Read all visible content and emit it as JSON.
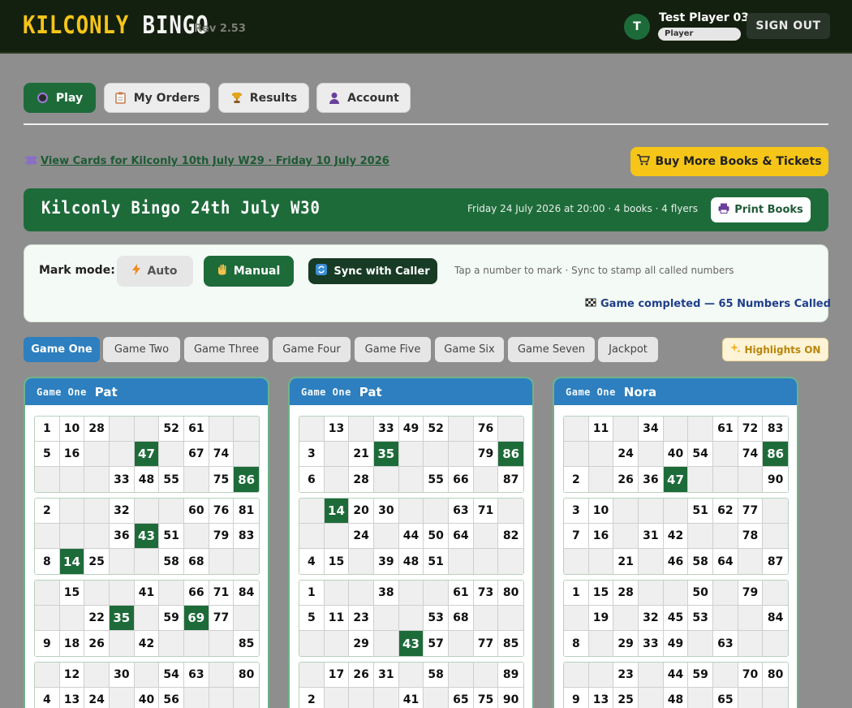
{
  "header": {
    "logo_primary": "KILCONLY",
    "logo_secondary": "BINGO",
    "revision": "Rev 2.53",
    "avatar_initial": "T",
    "user_name": "Test Player 03",
    "user_role": "Player",
    "sign_out": "SIGN OUT"
  },
  "nav": {
    "play": "Play",
    "orders": "My Orders",
    "results": "Results",
    "account": "Account"
  },
  "view_link": "View Cards for Kilconly 10th July W29 · Friday 10 July 2026",
  "buy_more": "Buy More Books & Tickets",
  "game": {
    "title": "Kilconly Bingo 24th July W30",
    "meta": "Friday 24 July 2026 at 20:00 · 4 books · 4 flyers",
    "print": "Print Books"
  },
  "mark": {
    "label": "Mark mode:",
    "auto": "Auto",
    "manual": "Manual",
    "sync": "Sync with Caller",
    "hint": "Tap a number to mark · Sync to stamp all called numbers",
    "status": "Game completed — 65 Numbers Called"
  },
  "tabs": [
    "Game One",
    "Game Two",
    "Game Three",
    "Game Four",
    "Game Five",
    "Game Six",
    "Game Seven",
    "Jackpot"
  ],
  "highlights": "Highlights ON",
  "colors": {
    "accent_green": "#1e6b3a",
    "accent_blue": "#2d7fbf",
    "accent_yellow": "#f5c518"
  },
  "books": [
    {
      "game": "Game One",
      "name": "Pat",
      "tickets": [
        [
          [
            1,
            10,
            28,
            null,
            null,
            52,
            61,
            null,
            null
          ],
          [
            5,
            16,
            null,
            null,
            47,
            null,
            67,
            74,
            null
          ],
          [
            null,
            null,
            null,
            33,
            48,
            55,
            null,
            75,
            86
          ]
        ],
        [
          [
            2,
            null,
            null,
            32,
            null,
            null,
            60,
            76,
            81
          ],
          [
            null,
            null,
            null,
            36,
            43,
            51,
            null,
            79,
            83
          ],
          [
            8,
            14,
            25,
            null,
            null,
            58,
            68,
            null,
            null
          ]
        ],
        [
          [
            null,
            15,
            null,
            null,
            41,
            null,
            66,
            71,
            84
          ],
          [
            null,
            null,
            22,
            35,
            null,
            59,
            69,
            77,
            null
          ],
          [
            9,
            18,
            26,
            null,
            42,
            null,
            null,
            null,
            85
          ]
        ],
        [
          [
            null,
            12,
            null,
            30,
            null,
            54,
            63,
            null,
            80
          ],
          [
            4,
            13,
            24,
            null,
            40,
            56,
            null,
            null,
            null
          ],
          [
            null,
            null,
            null,
            null,
            null,
            null,
            null,
            null,
            null
          ]
        ]
      ],
      "marked": [
        47,
        86,
        43,
        14,
        35,
        69
      ]
    },
    {
      "game": "Game One",
      "name": "Pat",
      "tickets": [
        [
          [
            null,
            13,
            null,
            33,
            49,
            52,
            null,
            76,
            null
          ],
          [
            3,
            null,
            21,
            35,
            null,
            null,
            null,
            79,
            86
          ],
          [
            6,
            null,
            28,
            null,
            null,
            55,
            66,
            null,
            87
          ]
        ],
        [
          [
            null,
            14,
            20,
            30,
            null,
            null,
            63,
            71,
            null
          ],
          [
            null,
            null,
            24,
            null,
            44,
            50,
            64,
            null,
            82
          ],
          [
            4,
            15,
            null,
            39,
            48,
            51,
            null,
            null,
            null
          ]
        ],
        [
          [
            1,
            null,
            null,
            38,
            null,
            null,
            61,
            73,
            80
          ],
          [
            5,
            11,
            23,
            null,
            null,
            53,
            68,
            null,
            null
          ],
          [
            null,
            null,
            29,
            null,
            43,
            57,
            null,
            77,
            85
          ]
        ],
        [
          [
            null,
            17,
            26,
            31,
            null,
            58,
            null,
            null,
            89
          ],
          [
            2,
            null,
            null,
            null,
            41,
            null,
            65,
            75,
            90
          ],
          [
            null,
            null,
            null,
            null,
            null,
            null,
            null,
            null,
            null
          ]
        ]
      ],
      "marked": [
        35,
        86,
        14,
        43
      ]
    },
    {
      "game": "Game One",
      "name": "Nora",
      "tickets": [
        [
          [
            null,
            11,
            null,
            34,
            null,
            null,
            61,
            72,
            83
          ],
          [
            null,
            null,
            24,
            null,
            40,
            54,
            null,
            74,
            86
          ],
          [
            2,
            null,
            26,
            36,
            47,
            null,
            null,
            null,
            90
          ]
        ],
        [
          [
            3,
            10,
            null,
            null,
            null,
            51,
            62,
            77,
            null
          ],
          [
            7,
            16,
            null,
            31,
            42,
            null,
            null,
            78,
            null
          ],
          [
            null,
            null,
            21,
            null,
            46,
            58,
            64,
            null,
            87
          ]
        ],
        [
          [
            1,
            15,
            28,
            null,
            null,
            50,
            null,
            79,
            null
          ],
          [
            null,
            19,
            null,
            32,
            45,
            53,
            null,
            null,
            84
          ],
          [
            8,
            null,
            29,
            33,
            49,
            null,
            63,
            null,
            null
          ]
        ],
        [
          [
            null,
            null,
            23,
            null,
            44,
            59,
            null,
            70,
            80
          ],
          [
            9,
            13,
            25,
            null,
            48,
            null,
            65,
            null,
            null
          ],
          [
            null,
            null,
            null,
            null,
            null,
            null,
            null,
            null,
            null
          ]
        ]
      ],
      "marked": [
        86,
        47
      ]
    }
  ]
}
